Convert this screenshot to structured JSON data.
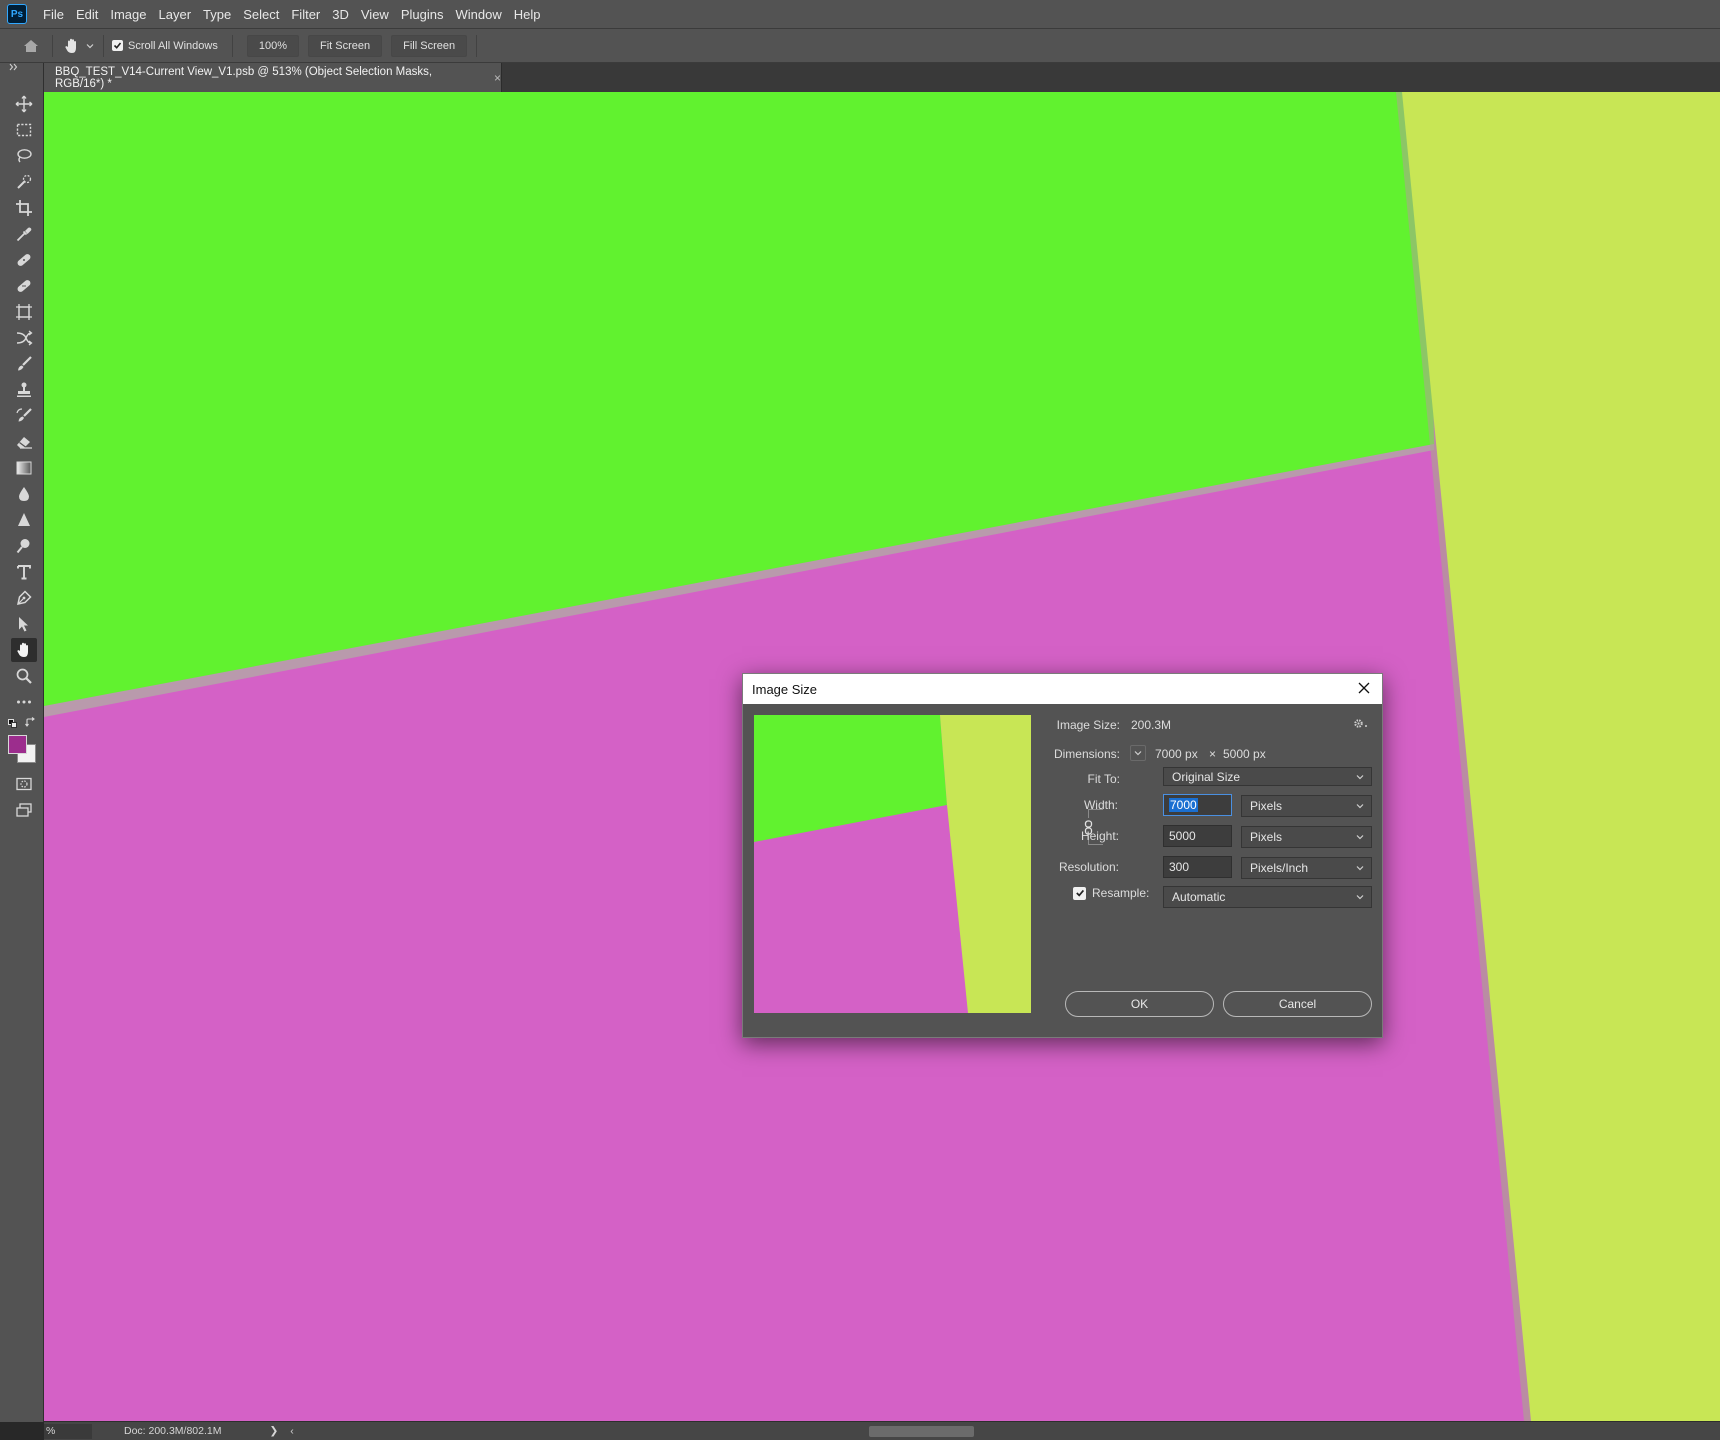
{
  "app": {
    "logo_text": "Ps",
    "logo_color": "#31a8ff"
  },
  "menu": [
    "File",
    "Edit",
    "Image",
    "Layer",
    "Type",
    "Select",
    "Filter",
    "3D",
    "View",
    "Plugins",
    "Window",
    "Help"
  ],
  "options_bar": {
    "tool_icon": "hand-icon",
    "scroll_all_windows_label": "Scroll All Windows",
    "scroll_all_windows_checked": true,
    "zoom_100_label": "100%",
    "fit_screen_label": "Fit Screen",
    "fill_screen_label": "Fill Screen"
  },
  "document_tab": {
    "title": "BBQ_TEST_V14-Current View_V1.psb @ 513% (Object Selection Masks, RGB/16*) *",
    "close_glyph": "×"
  },
  "tools": [
    {
      "name": "move-tool",
      "icon": "move-icon"
    },
    {
      "name": "marquee-tool",
      "icon": "rect-marquee-icon"
    },
    {
      "name": "lasso-tool",
      "icon": "lasso-icon"
    },
    {
      "name": "object-selection-tool",
      "icon": "quick-select-icon"
    },
    {
      "name": "crop-tool",
      "icon": "crop-icon"
    },
    {
      "name": "eyedropper-tool",
      "icon": "eyedropper-icon"
    },
    {
      "name": "spot-healing-tool",
      "icon": "bandage-icon"
    },
    {
      "name": "healing-brush-tool",
      "icon": "bandage-icon"
    },
    {
      "name": "frame-tool",
      "icon": "frame-icon"
    },
    {
      "name": "content-aware-move-tool",
      "icon": "cross-arrows-icon"
    },
    {
      "name": "brush-tool",
      "icon": "brush-icon"
    },
    {
      "name": "clone-stamp-tool",
      "icon": "stamp-icon"
    },
    {
      "name": "history-brush-tool",
      "icon": "history-brush-icon"
    },
    {
      "name": "eraser-tool",
      "icon": "eraser-icon"
    },
    {
      "name": "gradient-tool",
      "icon": "gradient-icon"
    },
    {
      "name": "blur-tool",
      "icon": "drop-icon"
    },
    {
      "name": "sharpen-tool",
      "icon": "triangle-icon"
    },
    {
      "name": "dodge-tool",
      "icon": "dodge-icon"
    },
    {
      "name": "type-tool",
      "icon": "type-icon"
    },
    {
      "name": "pen-tool",
      "icon": "pen-icon"
    },
    {
      "name": "path-selection-tool",
      "icon": "arrow-icon"
    },
    {
      "name": "hand-tool",
      "icon": "hand-icon",
      "active": true
    },
    {
      "name": "zoom-tool",
      "icon": "magnifier-icon"
    },
    {
      "name": "edit-toolbar",
      "icon": "more-icon"
    }
  ],
  "colors": {
    "foreground": "#9c2d8d",
    "background": "#f2f2f2",
    "canvas_green": "#61f22f",
    "canvas_magenta": "#d461c6",
    "canvas_yellow": "#c8e655"
  },
  "status_bar": {
    "zoom_text": "%",
    "doc_info": "Doc: 200.3M/802.1M",
    "arrow": "❯",
    "back_arrow": "‹"
  },
  "dialog": {
    "title": "Image Size",
    "image_size_label": "Image Size:",
    "image_size_value": "200.3M",
    "dimensions_label": "Dimensions:",
    "dimensions_width": "7000 px",
    "dimensions_times": "×",
    "dimensions_height": "5000 px",
    "fit_to_label": "Fit To:",
    "fit_to_value": "Original Size",
    "width_label": "Width:",
    "width_value": "7000",
    "width_unit": "Pixels",
    "height_label": "Height:",
    "height_value": "5000",
    "height_unit": "Pixels",
    "resolution_label": "Resolution:",
    "resolution_value": "300",
    "resolution_unit": "Pixels/Inch",
    "resample_label": "Resample:",
    "resample_checked": true,
    "resample_value": "Automatic",
    "ok_label": "OK",
    "cancel_label": "Cancel"
  }
}
